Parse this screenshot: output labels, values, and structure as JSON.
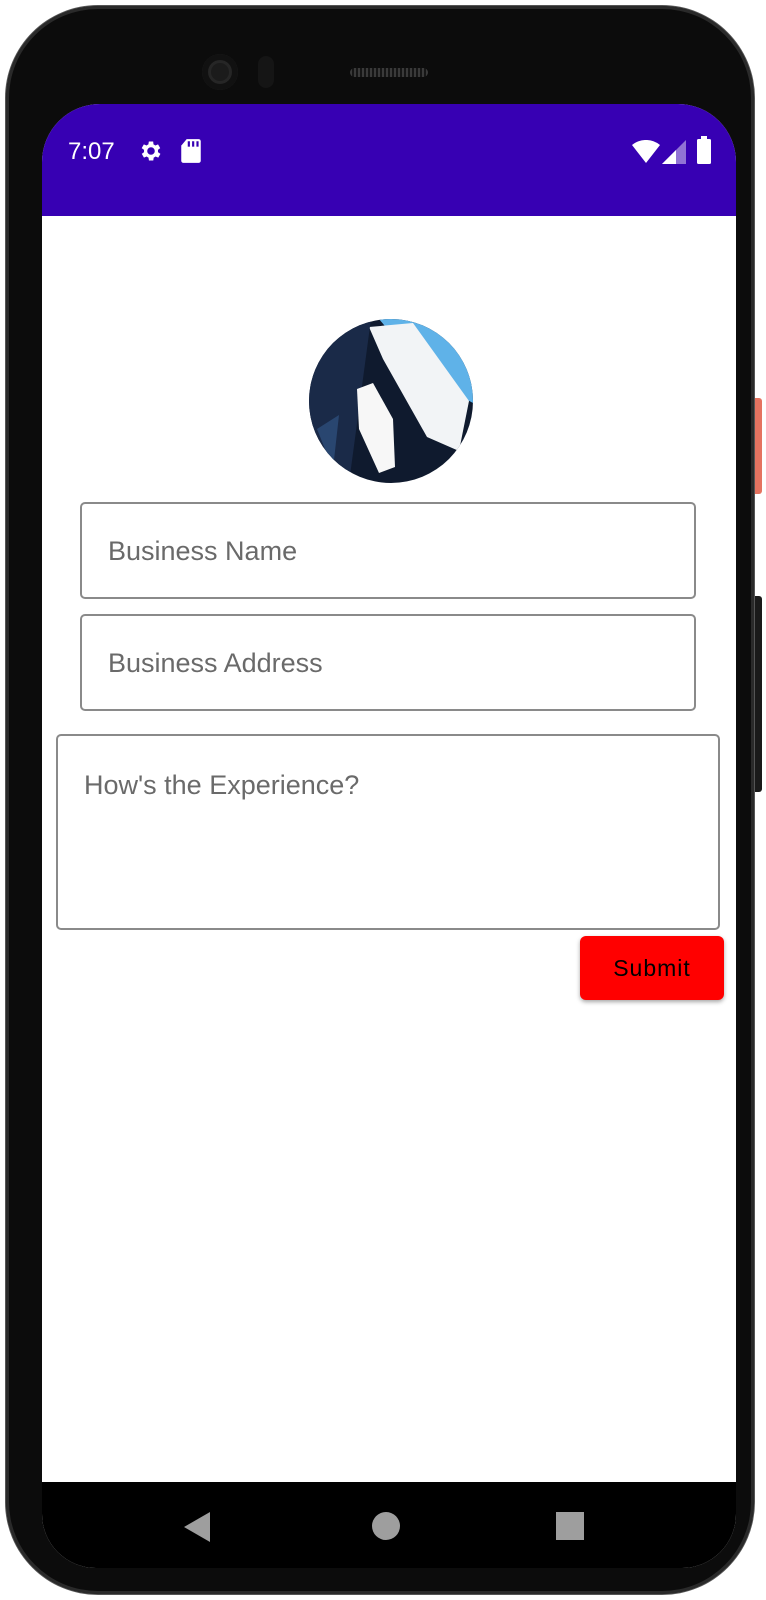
{
  "status_bar": {
    "time": "7:07",
    "background_color": "#3700b3",
    "icons": [
      "gear-icon",
      "sd-card-icon",
      "wifi-icon",
      "signal-icon",
      "battery-icon"
    ]
  },
  "form": {
    "avatar_icon": "profile-image",
    "business_name": {
      "value": "",
      "placeholder": "Business Name"
    },
    "business_address": {
      "value": "",
      "placeholder": "Business Address"
    },
    "experience": {
      "value": "",
      "placeholder": "How's the Experience?"
    },
    "submit_label": "Submit",
    "submit_color": "#ff0000"
  },
  "nav_bar": {
    "icons": [
      "back-icon",
      "home-icon",
      "recents-icon"
    ]
  }
}
